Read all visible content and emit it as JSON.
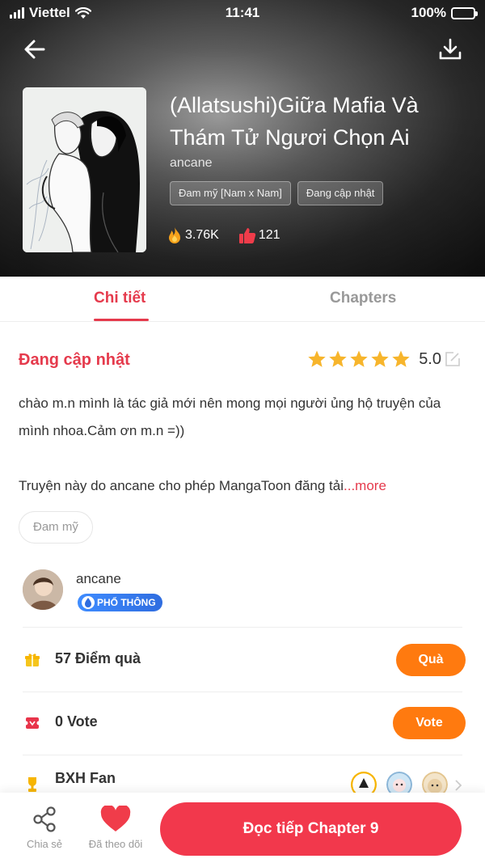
{
  "status_bar": {
    "carrier": "Viettel",
    "time": "11:41",
    "battery": "100%"
  },
  "manga": {
    "title": "(Allatsushi)Giữa Mafia Và Thám Tử Ngươi Chọn Ai",
    "author": "ancane",
    "tags": [
      "Đam mỹ [Nam x Nam]",
      "Đang cập nhật"
    ],
    "views": "3.76K",
    "likes": "121"
  },
  "tabs": [
    {
      "label": "Chi tiết",
      "active": true
    },
    {
      "label": "Chapters",
      "active": false
    }
  ],
  "detail": {
    "update_status": "Đang cập nhật",
    "rating": "5.0",
    "stars": 5,
    "description_line1": "chào m.n mình là tác giả mới nên mong mọi người ủng hộ truyện của mình nhoa.Cảm ơn m.n =))",
    "description_line2": "Truyện này do ancane cho phép MangaToon đăng tải",
    "more_label": "...more",
    "genre": "Đam mỹ"
  },
  "author_card": {
    "name": "ancane",
    "level_badge": "PHỔ THÔNG"
  },
  "gift": {
    "label": "57 Điểm quà",
    "button": "Quà"
  },
  "vote": {
    "label": "0 Vote",
    "button": "Vote"
  },
  "fans": {
    "label": "BXH Fan"
  },
  "bottom_bar": {
    "share_label": "Chia sẻ",
    "follow_label": "Đã theo dõi",
    "continue_label": "Đọc tiếp Chapter 9"
  },
  "colors": {
    "accent_red": "#e53a4c",
    "button_orange": "#ff7a0f",
    "continue_red": "#f2384c",
    "star_gold": "#f7b52c"
  },
  "icons": {
    "back": "arrow-left-icon",
    "download": "download-icon",
    "fire": "fire-icon",
    "thumb": "thumbs-up-icon",
    "star": "star-icon",
    "edit": "edit-icon",
    "gift": "gift-icon",
    "vote": "vote-ticket-icon",
    "fans": "trophy-icon",
    "share": "share-icon",
    "heart": "heart-icon"
  }
}
